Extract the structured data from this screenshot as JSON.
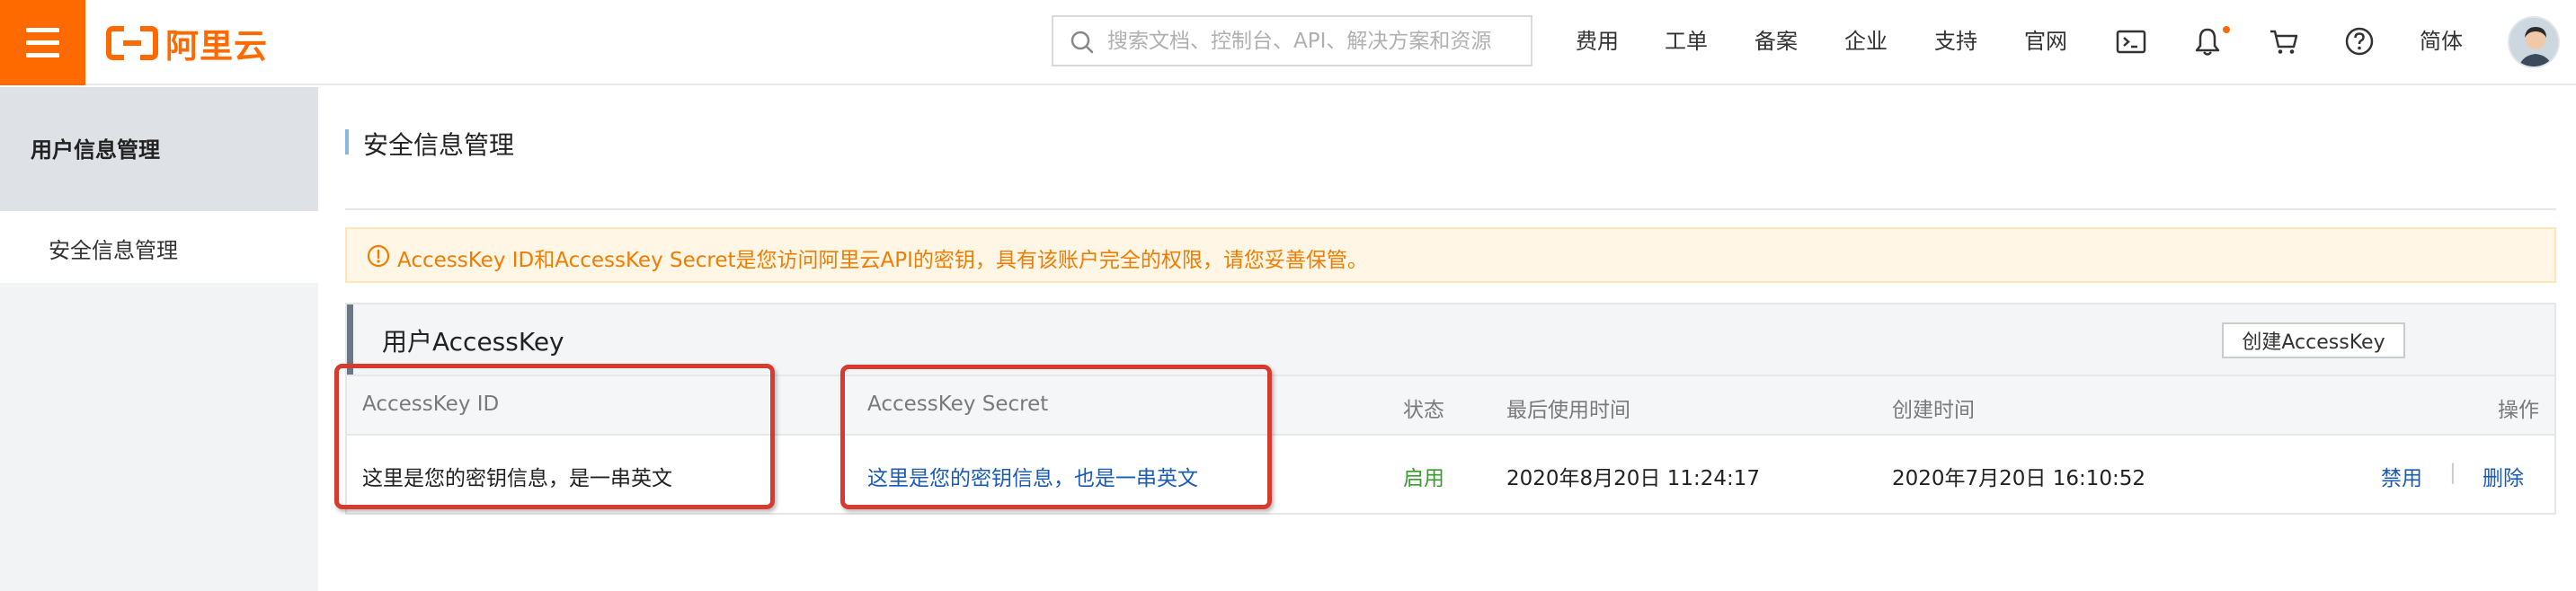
{
  "header": {
    "logo_text": "阿里云",
    "brand_color": "#ff6a00",
    "search": {
      "placeholder": "搜索文档、控制台、API、解决方案和资源",
      "value": ""
    },
    "nav": {
      "billing": "费用",
      "tickets": "工单",
      "icp": "备案",
      "enterprise": "企业",
      "support": "支持",
      "official_site": "官网",
      "language": "简体"
    },
    "icons": [
      "menu-icon",
      "terminal-icon",
      "bell-icon",
      "cart-icon",
      "help-icon"
    ]
  },
  "sidebar": {
    "section_title": "用户信息管理",
    "items": [
      {
        "label": "安全信息管理",
        "active": true
      }
    ]
  },
  "main": {
    "page_title": "安全信息管理",
    "alert": {
      "icon": "warning-circle-icon",
      "text": "AccessKey ID和AccessKey Secret是您访问阿里云API的密钥，具有该账户完全的权限，请您妥善保管。"
    },
    "panel": {
      "title": "用户AccessKey",
      "create_button": "创建AccessKey",
      "columns": {
        "id": "AccessKey ID",
        "secret": "AccessKey Secret",
        "status": "状态",
        "last_used": "最后使用时间",
        "created": "创建时间",
        "actions": "操作"
      },
      "rows": [
        {
          "id": "这里是您的密钥信息，是一串英文",
          "secret": "这里是您的密钥信息，也是一串英文",
          "status": "启用",
          "last_used": "2020年8月20日 11:24:17",
          "created": "2020年7月20日 16:10:52",
          "action_disable": "禁用",
          "action_separator": "|",
          "action_delete": "删除"
        }
      ]
    }
  },
  "colors": {
    "accent": "#ff6a00",
    "link": "#1b5bb5",
    "status_enabled": "#3b9c2f",
    "alert_text": "#f07c00",
    "highlight_box": "#d93a2f"
  }
}
